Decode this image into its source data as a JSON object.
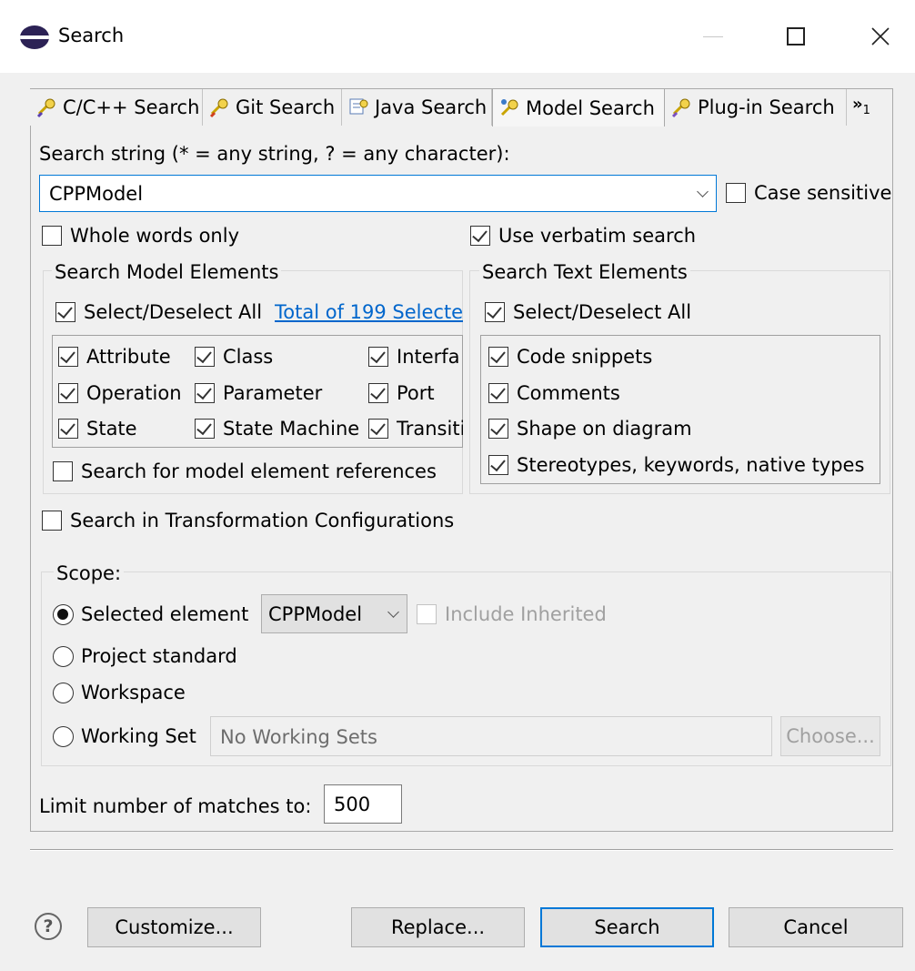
{
  "window": {
    "title": "Search"
  },
  "tabs": [
    {
      "label": "C/C++ Search",
      "icon": "search-lamp-icon",
      "active": false
    },
    {
      "label": "Git Search",
      "icon": "git-search-icon",
      "active": false
    },
    {
      "label": "Java Search",
      "icon": "java-search-icon",
      "active": false
    },
    {
      "label": "Model Search",
      "icon": "model-search-icon",
      "active": true
    },
    {
      "label": "Plug-in Search",
      "icon": "plugin-search-icon",
      "active": false
    }
  ],
  "tabs_overflow": {
    "label": "»",
    "count": "1"
  },
  "search": {
    "label": "Search string (* = any string, ? = any character):",
    "value": "CPPModel",
    "case_sensitive_label": "Case sensitive",
    "case_sensitive": false,
    "whole_words_label": "Whole words only",
    "whole_words": false,
    "verbatim_label": "Use verbatim search",
    "verbatim": true
  },
  "model_elements": {
    "title": "Search Model Elements",
    "select_all_label": "Select/Deselect All",
    "total_link": "Total of 199 Selecte",
    "items": [
      {
        "label": "Attribute",
        "checked": true
      },
      {
        "label": "Class",
        "checked": true
      },
      {
        "label": "Interfa",
        "checked": true
      },
      {
        "label": "Operation",
        "checked": true
      },
      {
        "label": "Parameter",
        "checked": true
      },
      {
        "label": "Port",
        "checked": true
      },
      {
        "label": "State",
        "checked": true
      },
      {
        "label": "State Machine",
        "checked": true
      },
      {
        "label": "Transiti",
        "checked": true
      }
    ],
    "references_label": "Search for model element references"
  },
  "text_elements": {
    "title": "Search Text Elements",
    "select_all_label": "Select/Deselect All",
    "items": [
      {
        "label": "Code snippets",
        "checked": true
      },
      {
        "label": "Comments",
        "checked": true
      },
      {
        "label": "Shape on diagram",
        "checked": true
      },
      {
        "label": "Stereotypes, keywords, native types",
        "checked": true
      }
    ]
  },
  "transformation_label": "Search in Transformation Configurations",
  "scope": {
    "title": "Scope:",
    "selected_element_label": "Selected element",
    "selected_element_value": "CPPModel",
    "include_inherited_label": "Include Inherited",
    "project_standard_label": "Project standard",
    "workspace_label": "Workspace",
    "working_set_label": "Working Set",
    "working_set_value": "No Working Sets",
    "choose_label": "Choose..."
  },
  "limit": {
    "label": "Limit number of matches to:",
    "value": "500"
  },
  "buttons": {
    "customize": "Customize...",
    "replace": "Replace...",
    "search": "Search",
    "cancel": "Cancel"
  },
  "help_symbol": "?",
  "colors": {
    "accent": "#0078d7",
    "link": "#0066cc"
  }
}
